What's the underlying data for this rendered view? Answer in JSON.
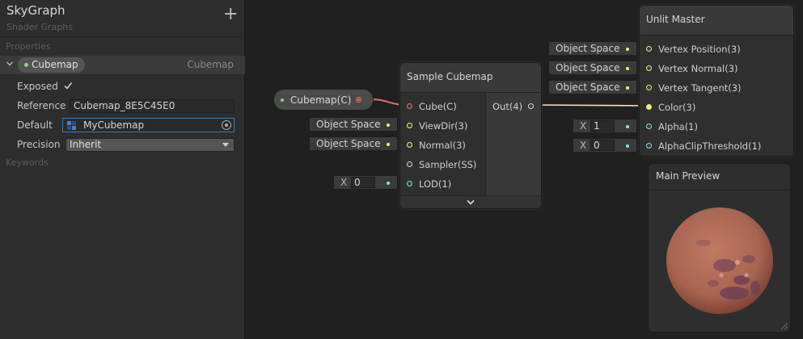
{
  "blackboard": {
    "title": "SkyGraph",
    "subtitle": "Shader Graphs",
    "add_icon": "plus-icon",
    "properties_header": "Properties",
    "keywords_header": "Keywords",
    "property": {
      "name": "Cubemap",
      "type": "Cubemap",
      "exposed_label": "Exposed",
      "exposed": true,
      "reference_label": "Reference",
      "reference_value": "Cubemap_8E5C45E0",
      "default_label": "Default",
      "default_value": "MyCubemap",
      "precision_label": "Precision",
      "precision_value": "Inherit"
    }
  },
  "graph": {
    "property_node": {
      "label": "Cubemap(C)"
    },
    "sample_cubemap": {
      "title": "Sample Cubemap",
      "inputs": [
        "Cube(C)",
        "ViewDir(3)",
        "Normal(3)",
        "Sampler(SS)",
        "LOD(1)"
      ],
      "output": "Out(4)",
      "viewdir_chip": "Object Space",
      "normal_chip": "Object Space",
      "lod_x_label": "X",
      "lod_value": "0"
    },
    "unlit_master": {
      "title": "Unlit Master",
      "inputs": [
        "Vertex Position(3)",
        "Vertex Normal(3)",
        "Vertex Tangent(3)",
        "Color(3)",
        "Alpha(1)",
        "AlphaClipThreshold(1)"
      ],
      "position_chip": "Object Space",
      "normal_chip": "Object Space",
      "tangent_chip": "Object Space",
      "alpha_x_label": "X",
      "alpha_value": "1",
      "clip_x_label": "X",
      "clip_value": "0"
    },
    "preview": {
      "title": "Main Preview"
    }
  },
  "colors": {
    "cubemap_port": "#ea6a6a",
    "vector3_port": "#f2f07a",
    "vector1_port": "#84e4e7",
    "vector4_port": "#fbcbf4",
    "property_dot": "#8fd186",
    "selection_border": "#3a79bb"
  }
}
